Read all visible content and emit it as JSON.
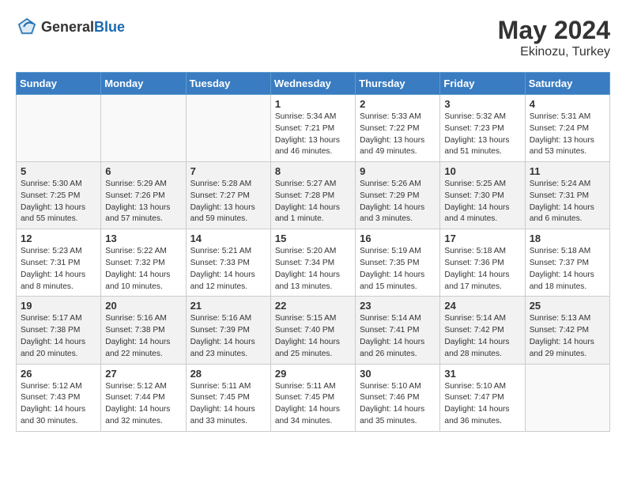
{
  "header": {
    "logo_general": "General",
    "logo_blue": "Blue",
    "month_year": "May 2024",
    "location": "Ekinozu, Turkey"
  },
  "days_of_week": [
    "Sunday",
    "Monday",
    "Tuesday",
    "Wednesday",
    "Thursday",
    "Friday",
    "Saturday"
  ],
  "weeks": [
    {
      "alt": false,
      "days": [
        {
          "num": "",
          "sunrise": "",
          "sunset": "",
          "daylight": ""
        },
        {
          "num": "",
          "sunrise": "",
          "sunset": "",
          "daylight": ""
        },
        {
          "num": "",
          "sunrise": "",
          "sunset": "",
          "daylight": ""
        },
        {
          "num": "1",
          "sunrise": "Sunrise: 5:34 AM",
          "sunset": "Sunset: 7:21 PM",
          "daylight": "Daylight: 13 hours and 46 minutes."
        },
        {
          "num": "2",
          "sunrise": "Sunrise: 5:33 AM",
          "sunset": "Sunset: 7:22 PM",
          "daylight": "Daylight: 13 hours and 49 minutes."
        },
        {
          "num": "3",
          "sunrise": "Sunrise: 5:32 AM",
          "sunset": "Sunset: 7:23 PM",
          "daylight": "Daylight: 13 hours and 51 minutes."
        },
        {
          "num": "4",
          "sunrise": "Sunrise: 5:31 AM",
          "sunset": "Sunset: 7:24 PM",
          "daylight": "Daylight: 13 hours and 53 minutes."
        }
      ]
    },
    {
      "alt": true,
      "days": [
        {
          "num": "5",
          "sunrise": "Sunrise: 5:30 AM",
          "sunset": "Sunset: 7:25 PM",
          "daylight": "Daylight: 13 hours and 55 minutes."
        },
        {
          "num": "6",
          "sunrise": "Sunrise: 5:29 AM",
          "sunset": "Sunset: 7:26 PM",
          "daylight": "Daylight: 13 hours and 57 minutes."
        },
        {
          "num": "7",
          "sunrise": "Sunrise: 5:28 AM",
          "sunset": "Sunset: 7:27 PM",
          "daylight": "Daylight: 13 hours and 59 minutes."
        },
        {
          "num": "8",
          "sunrise": "Sunrise: 5:27 AM",
          "sunset": "Sunset: 7:28 PM",
          "daylight": "Daylight: 14 hours and 1 minute."
        },
        {
          "num": "9",
          "sunrise": "Sunrise: 5:26 AM",
          "sunset": "Sunset: 7:29 PM",
          "daylight": "Daylight: 14 hours and 3 minutes."
        },
        {
          "num": "10",
          "sunrise": "Sunrise: 5:25 AM",
          "sunset": "Sunset: 7:30 PM",
          "daylight": "Daylight: 14 hours and 4 minutes."
        },
        {
          "num": "11",
          "sunrise": "Sunrise: 5:24 AM",
          "sunset": "Sunset: 7:31 PM",
          "daylight": "Daylight: 14 hours and 6 minutes."
        }
      ]
    },
    {
      "alt": false,
      "days": [
        {
          "num": "12",
          "sunrise": "Sunrise: 5:23 AM",
          "sunset": "Sunset: 7:31 PM",
          "daylight": "Daylight: 14 hours and 8 minutes."
        },
        {
          "num": "13",
          "sunrise": "Sunrise: 5:22 AM",
          "sunset": "Sunset: 7:32 PM",
          "daylight": "Daylight: 14 hours and 10 minutes."
        },
        {
          "num": "14",
          "sunrise": "Sunrise: 5:21 AM",
          "sunset": "Sunset: 7:33 PM",
          "daylight": "Daylight: 14 hours and 12 minutes."
        },
        {
          "num": "15",
          "sunrise": "Sunrise: 5:20 AM",
          "sunset": "Sunset: 7:34 PM",
          "daylight": "Daylight: 14 hours and 13 minutes."
        },
        {
          "num": "16",
          "sunrise": "Sunrise: 5:19 AM",
          "sunset": "Sunset: 7:35 PM",
          "daylight": "Daylight: 14 hours and 15 minutes."
        },
        {
          "num": "17",
          "sunrise": "Sunrise: 5:18 AM",
          "sunset": "Sunset: 7:36 PM",
          "daylight": "Daylight: 14 hours and 17 minutes."
        },
        {
          "num": "18",
          "sunrise": "Sunrise: 5:18 AM",
          "sunset": "Sunset: 7:37 PM",
          "daylight": "Daylight: 14 hours and 18 minutes."
        }
      ]
    },
    {
      "alt": true,
      "days": [
        {
          "num": "19",
          "sunrise": "Sunrise: 5:17 AM",
          "sunset": "Sunset: 7:38 PM",
          "daylight": "Daylight: 14 hours and 20 minutes."
        },
        {
          "num": "20",
          "sunrise": "Sunrise: 5:16 AM",
          "sunset": "Sunset: 7:38 PM",
          "daylight": "Daylight: 14 hours and 22 minutes."
        },
        {
          "num": "21",
          "sunrise": "Sunrise: 5:16 AM",
          "sunset": "Sunset: 7:39 PM",
          "daylight": "Daylight: 14 hours and 23 minutes."
        },
        {
          "num": "22",
          "sunrise": "Sunrise: 5:15 AM",
          "sunset": "Sunset: 7:40 PM",
          "daylight": "Daylight: 14 hours and 25 minutes."
        },
        {
          "num": "23",
          "sunrise": "Sunrise: 5:14 AM",
          "sunset": "Sunset: 7:41 PM",
          "daylight": "Daylight: 14 hours and 26 minutes."
        },
        {
          "num": "24",
          "sunrise": "Sunrise: 5:14 AM",
          "sunset": "Sunset: 7:42 PM",
          "daylight": "Daylight: 14 hours and 28 minutes."
        },
        {
          "num": "25",
          "sunrise": "Sunrise: 5:13 AM",
          "sunset": "Sunset: 7:42 PM",
          "daylight": "Daylight: 14 hours and 29 minutes."
        }
      ]
    },
    {
      "alt": false,
      "days": [
        {
          "num": "26",
          "sunrise": "Sunrise: 5:12 AM",
          "sunset": "Sunset: 7:43 PM",
          "daylight": "Daylight: 14 hours and 30 minutes."
        },
        {
          "num": "27",
          "sunrise": "Sunrise: 5:12 AM",
          "sunset": "Sunset: 7:44 PM",
          "daylight": "Daylight: 14 hours and 32 minutes."
        },
        {
          "num": "28",
          "sunrise": "Sunrise: 5:11 AM",
          "sunset": "Sunset: 7:45 PM",
          "daylight": "Daylight: 14 hours and 33 minutes."
        },
        {
          "num": "29",
          "sunrise": "Sunrise: 5:11 AM",
          "sunset": "Sunset: 7:45 PM",
          "daylight": "Daylight: 14 hours and 34 minutes."
        },
        {
          "num": "30",
          "sunrise": "Sunrise: 5:10 AM",
          "sunset": "Sunset: 7:46 PM",
          "daylight": "Daylight: 14 hours and 35 minutes."
        },
        {
          "num": "31",
          "sunrise": "Sunrise: 5:10 AM",
          "sunset": "Sunset: 7:47 PM",
          "daylight": "Daylight: 14 hours and 36 minutes."
        },
        {
          "num": "",
          "sunrise": "",
          "sunset": "",
          "daylight": ""
        }
      ]
    }
  ]
}
